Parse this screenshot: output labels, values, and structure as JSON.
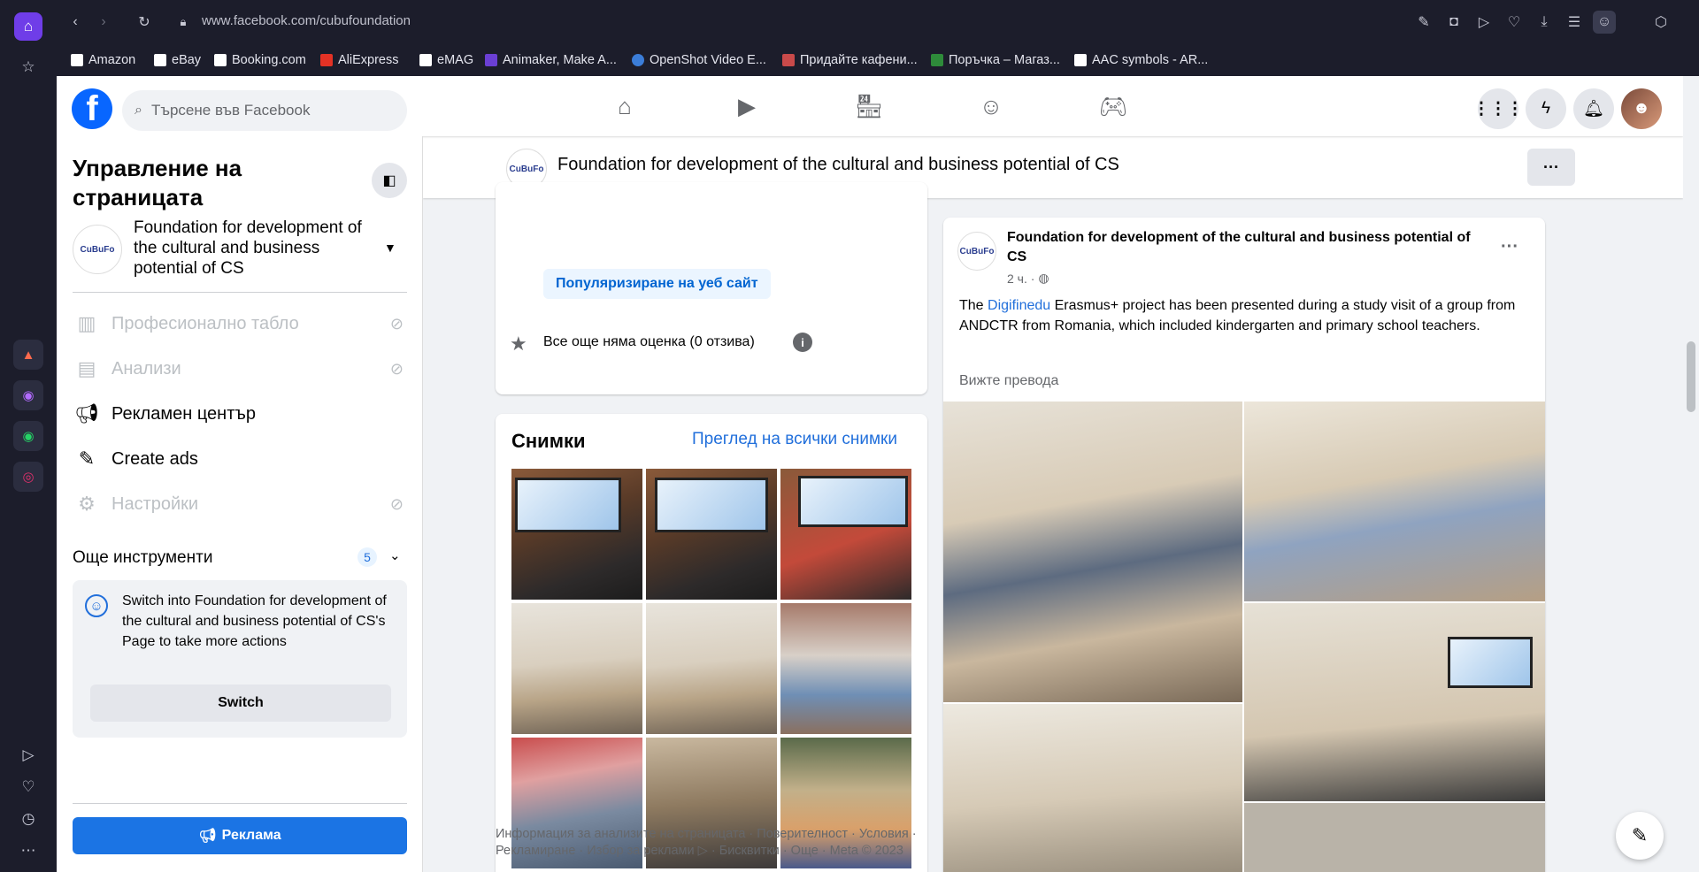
{
  "browser": {
    "url": "www.facebook.com/cubufoundation",
    "bookmarks": [
      {
        "label": "Amazon",
        "color": "#ffffff"
      },
      {
        "label": "eBay",
        "color": "#ffffff"
      },
      {
        "label": "Booking.com",
        "color": "#ffffff"
      },
      {
        "label": "AliExpress",
        "color": "#e43225"
      },
      {
        "label": "eMAG",
        "color": "#ffffff"
      },
      {
        "label": "Animaker, Make A...",
        "color": "#6b3fd4"
      },
      {
        "label": "OpenShot Video E...",
        "color": "#3b7dd8"
      },
      {
        "label": "Придайте кафени...",
        "color": "#ffffff"
      },
      {
        "label": "Поръчка – Магаз...",
        "color": "#2e8b3a"
      },
      {
        "label": "AAC symbols - AR...",
        "color": "#ffffff"
      }
    ]
  },
  "fb": {
    "search_placeholder": "Търсене във Facebook",
    "brand_color": "#0866ff"
  },
  "left": {
    "title": "Управление на страницата",
    "page_name": "Foundation for development of the cultural and business potential of CS",
    "avatar_text": "CuBuFo",
    "items": [
      {
        "label": "Професионално табло",
        "disabled": true
      },
      {
        "label": "Анализи",
        "disabled": true
      },
      {
        "label": "Рекламен център",
        "disabled": false
      },
      {
        "label": "Create ads",
        "disabled": false
      },
      {
        "label": "Настройки",
        "disabled": true
      }
    ],
    "more_tools": "Още инструменти",
    "more_tools_count": "5",
    "switch_text": "Switch into Foundation for development of the cultural and business potential of CS's Page to take more actions",
    "switch_button": "Switch",
    "ad_button": "Реклама"
  },
  "strip": {
    "page_name": "Foundation for development of the cultural and business potential of CS",
    "avatar_text": "CuBuFo"
  },
  "info": {
    "promote": "Популяризиране на уеб сайт",
    "rating": "Все още няма оценка (0 отзива)"
  },
  "photos": {
    "title": "Снимки",
    "see_all": "Преглед на всички снимки"
  },
  "footer": {
    "line1": "Информация за анализите на страницата · Поверителност · Условия ·",
    "line2": "Рекламиране · Избор за реклами ▷ · Бисквитки · Още · Meta © 2023"
  },
  "post": {
    "author": "Foundation for development of the cultural and business potential of CS",
    "time": "2 ч. ·",
    "text_pre": "The ",
    "text_link": "Digifinedu",
    "text_post": " Erasmus+ project has been presented during a study visit of a group from ANDCTR from Romania, which included kindergarten and primary school teachers.",
    "translate": "Вижте превода",
    "avatar_text": "CuBuFo"
  }
}
